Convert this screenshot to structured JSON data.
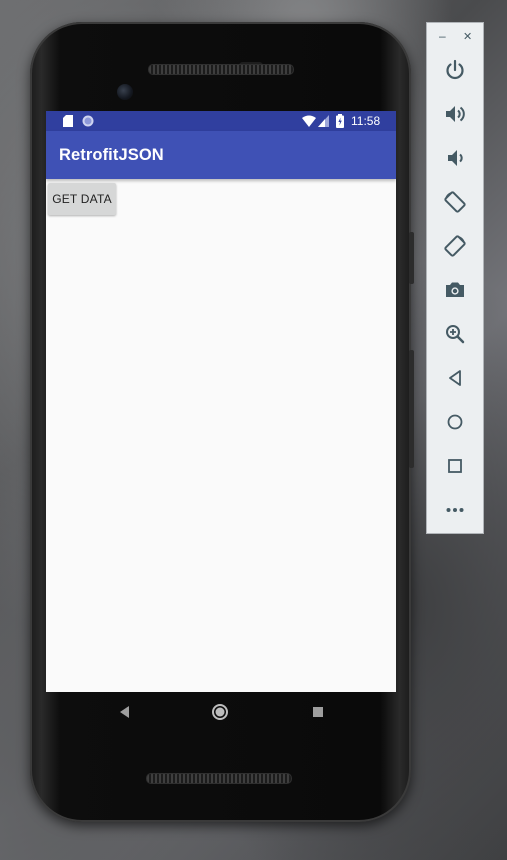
{
  "status_bar": {
    "time": "11:58",
    "icons": [
      "sd-card-icon",
      "sync-icon",
      "wifi-icon",
      "signal-icon",
      "battery-icon"
    ]
  },
  "app": {
    "title": "RetrofitJSON",
    "get_data_button": "GET DATA"
  },
  "navigation": [
    "back-icon",
    "home-icon",
    "recents-icon"
  ],
  "emulator_toolbar": {
    "minimize_label": "–",
    "close_label": "✕",
    "tools": [
      "power",
      "volume-up",
      "volume-down",
      "rotate-left",
      "rotate-right",
      "camera",
      "zoom",
      "back",
      "home",
      "overview",
      "more"
    ]
  },
  "colors": {
    "status_bar": "#303f9f",
    "app_bar": "#3f51b5",
    "button": "#d6d7d7",
    "screen_bg": "#fafafa",
    "toolbar_icon": "#455a64"
  }
}
